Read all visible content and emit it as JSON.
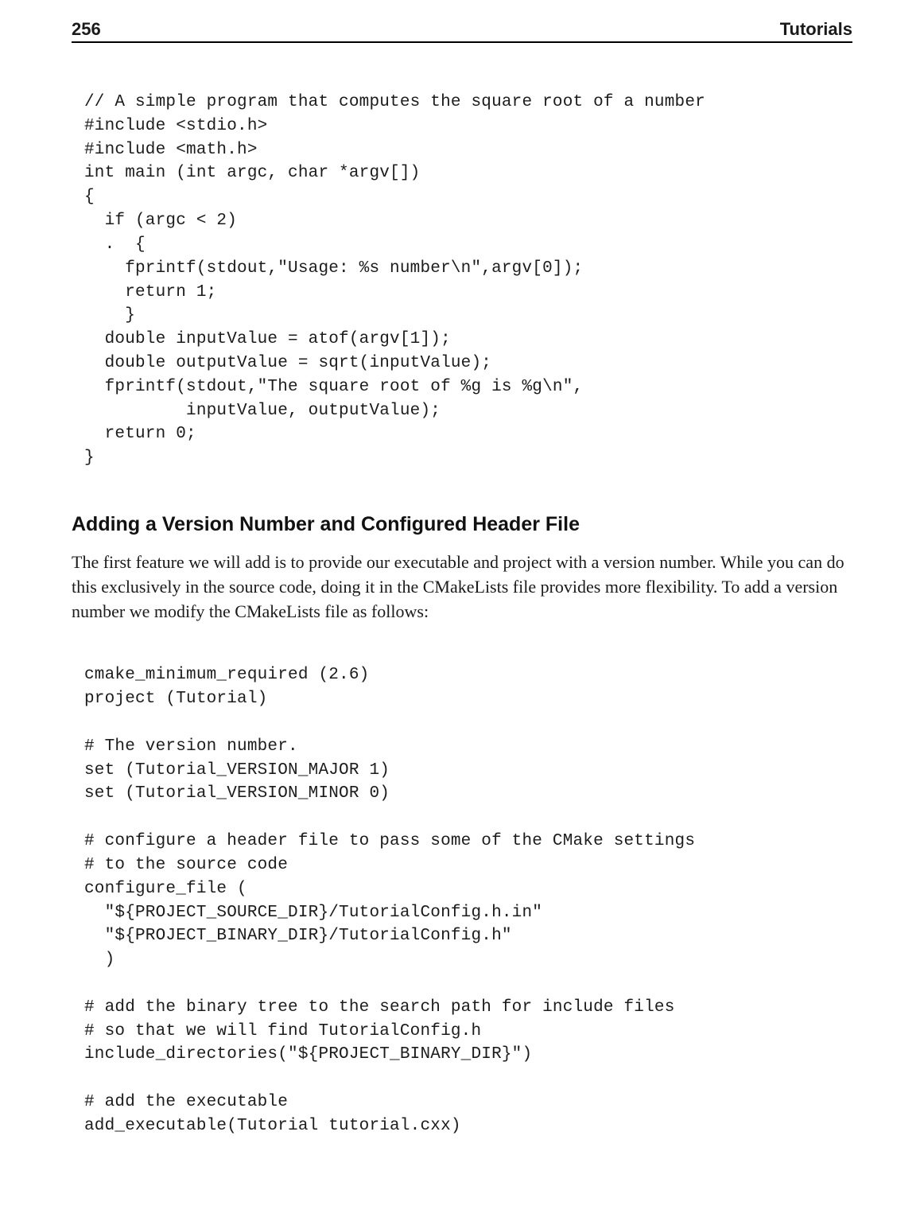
{
  "header": {
    "page_number": "256",
    "category": "Tutorials"
  },
  "code_block_1": "// A simple program that computes the square root of a number\n#include <stdio.h>\n#include <math.h>\nint main (int argc, char *argv[])\n{\n  if (argc < 2)\n  .  {\n    fprintf(stdout,\"Usage: %s number\\n\",argv[0]);\n    return 1;\n    }\n  double inputValue = atof(argv[1]);\n  double outputValue = sqrt(inputValue);\n  fprintf(stdout,\"The square root of %g is %g\\n\",\n          inputValue, outputValue);\n  return 0;\n}",
  "section": {
    "heading": "Adding a Version Number and Configured Header File",
    "paragraph": "The first feature we will add is to provide our executable and project with a version number. While you can do this exclusively in the source code, doing it in the CMakeLists file provides more flexibility. To add a version number we modify the CMakeLists file as follows:"
  },
  "code_block_2": "cmake_minimum_required (2.6)\nproject (Tutorial)\n\n# The version number.\nset (Tutorial_VERSION_MAJOR 1)\nset (Tutorial_VERSION_MINOR 0)\n\n# configure a header file to pass some of the CMake settings\n# to the source code\nconfigure_file (\n  \"${PROJECT_SOURCE_DIR}/TutorialConfig.h.in\"\n  \"${PROJECT_BINARY_DIR}/TutorialConfig.h\"\n  )\n\n# add the binary tree to the search path for include files\n# so that we will find TutorialConfig.h\ninclude_directories(\"${PROJECT_BINARY_DIR}\")\n\n# add the executable\nadd_executable(Tutorial tutorial.cxx)"
}
